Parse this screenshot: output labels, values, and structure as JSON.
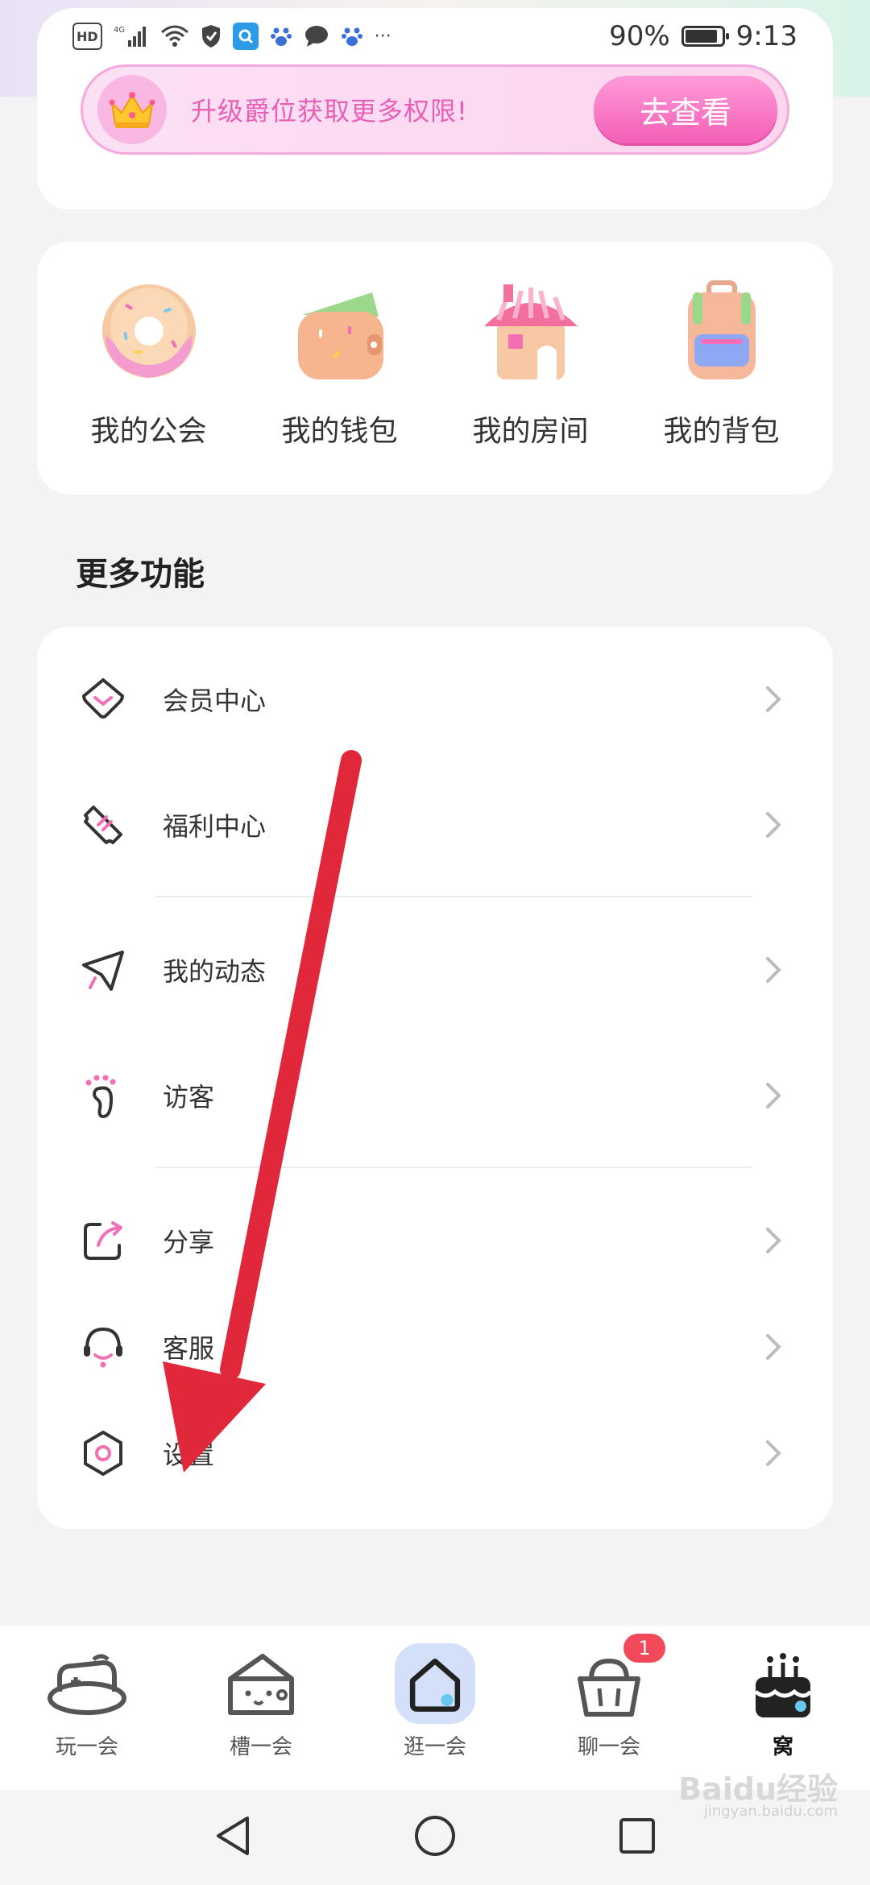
{
  "status_bar": {
    "hd": "HD",
    "network": "4G",
    "battery_percent": "90%",
    "battery_level": 0.9,
    "time": "9:13",
    "more": "···"
  },
  "vip_banner": {
    "text": "升级爵位获取更多权限!",
    "button": "去查看"
  },
  "tiles": [
    {
      "label": "我的公会",
      "icon": "donut-icon"
    },
    {
      "label": "我的钱包",
      "icon": "wallet-icon"
    },
    {
      "label": "我的房间",
      "icon": "house-icon"
    },
    {
      "label": "我的背包",
      "icon": "backpack-icon"
    }
  ],
  "section_title": "更多功能",
  "menu": [
    {
      "label": "会员中心",
      "icon": "diamond-heart-icon"
    },
    {
      "label": "福利中心",
      "icon": "ticket-icon"
    },
    {
      "label": "我的动态",
      "icon": "paper-plane-icon"
    },
    {
      "label": "访客",
      "icon": "footprint-icon"
    },
    {
      "label": "分享",
      "icon": "share-icon"
    },
    {
      "label": "客服",
      "icon": "headset-icon"
    },
    {
      "label": "设置",
      "icon": "hexagon-settings-icon"
    }
  ],
  "bottom_nav": [
    {
      "label": "玩一会",
      "icon": "play-icon"
    },
    {
      "label": "槽一会",
      "icon": "cheese-icon"
    },
    {
      "label": "逛一会",
      "icon": "home-icon"
    },
    {
      "label": "聊一会",
      "icon": "basket-icon",
      "badge": "1"
    },
    {
      "label": "窝",
      "icon": "cake-icon",
      "active": true
    }
  ],
  "watermark": {
    "text": "Baidu经验",
    "sub": "jingyan.baidu.com"
  },
  "colors": {
    "accent_pink": "#f35fb7",
    "annotation_red": "#e0283a",
    "badge_red": "#f2495b"
  }
}
